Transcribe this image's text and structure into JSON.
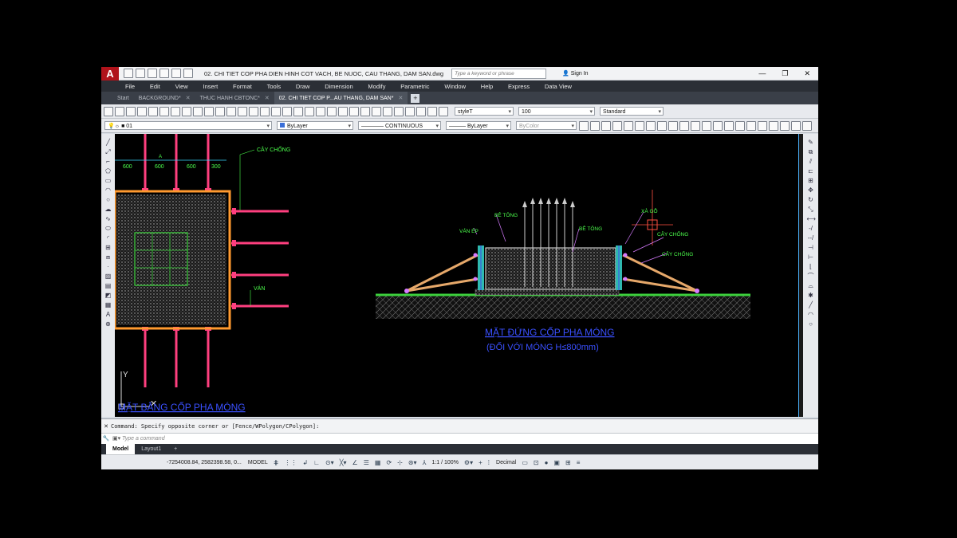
{
  "app": {
    "logo": "A",
    "document_title": "02. CHI TIET COP PHA DIEN HINH COT VACH, BE NUOC, CAU THANG, DAM SAN.dwg",
    "search_placeholder": "Type a keyword or phrase",
    "sign_in": "Sign In",
    "window_buttons": [
      "—",
      "❐",
      "✕"
    ]
  },
  "menu": [
    "File",
    "Edit",
    "View",
    "Insert",
    "Format",
    "Tools",
    "Draw",
    "Dimension",
    "Modify",
    "Parametric",
    "Window",
    "Help",
    "Express",
    "Data View"
  ],
  "file_tabs": [
    {
      "label": "Start",
      "active": false,
      "closable": false
    },
    {
      "label": "BACKGROUND*",
      "active": false,
      "closable": true
    },
    {
      "label": "THUC HANH CBTONC*",
      "active": false,
      "closable": true
    },
    {
      "label": "02. CHI TIET COP P...AU THANG, DAM SAN*",
      "active": true,
      "closable": true
    }
  ],
  "toolbar1": {
    "text_style": "styleT",
    "dim_scale": "100",
    "table_style": "Standard"
  },
  "toolbar2": {
    "layer": "01",
    "color": "ByLayer",
    "linetype": "CONTINUOUS",
    "lineweight": "ByLayer",
    "plot_style": "ByColor"
  },
  "drawing": {
    "left_labels": {
      "cay_chong": "CÂY CHỐNG",
      "dims": [
        "600",
        "600",
        "600",
        "300"
      ],
      "dim_a": "A",
      "van": "VÁN",
      "title": "MẶT BẰNG CỐP PHA MÓNG"
    },
    "right_labels": {
      "be_tong_1": "BÊ TÔNG",
      "be_tong_2": "BÊ TÔNG",
      "van_ep": "VÁN ÉP",
      "xa_go": "XÀ GỖ",
      "cay_chong_1": "CÂY CHỐNG",
      "cay_chong_2": "CÂY CHỐNG",
      "title": "MẶT ĐỨNG CỐP PHA MÓNG",
      "subtitle": "(ĐỐI VỚI MÓNG H≤800mm)"
    },
    "ucs": {
      "y": "Y"
    }
  },
  "command": {
    "history": "Command: Specify opposite corner or [Fence/WPolygon/CPolygon]:",
    "placeholder": "Type a command"
  },
  "layout_tabs": [
    "Model",
    "Layout1"
  ],
  "status": {
    "coords": "-7254008.84, 2582398.58, 0...",
    "space": "MODEL",
    "scale": "1:1 / 100%",
    "units": "Decimal"
  }
}
